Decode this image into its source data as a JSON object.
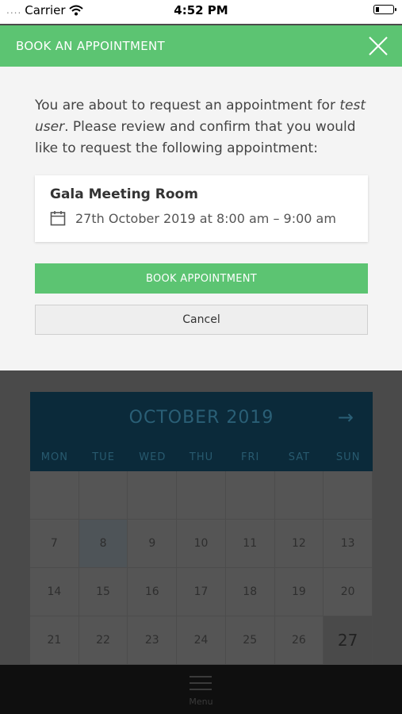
{
  "status_bar": {
    "carrier": "Carrier",
    "time": "4:52 PM",
    "signal_dots": "....",
    "battery_level": 0.15
  },
  "modal": {
    "title": "BOOK AN APPOINTMENT",
    "intro_part1": "You are about to request an appointment for ",
    "intro_user": "test user",
    "intro_part2": ". Please review and confirm that you would like to request the following appointment:",
    "room": "Gala Meeting Room",
    "date_time": "27th October 2019 at 8:00 am – 9:00 am",
    "book_label": "BOOK APPOINTMENT",
    "cancel_label": "Cancel",
    "accent_color": "#5cc472"
  },
  "calendar": {
    "month_title": "OCTOBER 2019",
    "weekdays": [
      "MON",
      "TUE",
      "WED",
      "THU",
      "FRI",
      "SAT",
      "SUN"
    ],
    "rows": [
      [
        "",
        "",
        "",
        "",
        "",
        "",
        ""
      ],
      [
        "7",
        "8",
        "9",
        "10",
        "11",
        "12",
        "13"
      ],
      [
        "14",
        "15",
        "16",
        "17",
        "18",
        "19",
        "20"
      ],
      [
        "21",
        "22",
        "23",
        "24",
        "25",
        "26",
        "27"
      ]
    ],
    "selected_day": "27"
  },
  "menu": {
    "label": "Menu"
  }
}
